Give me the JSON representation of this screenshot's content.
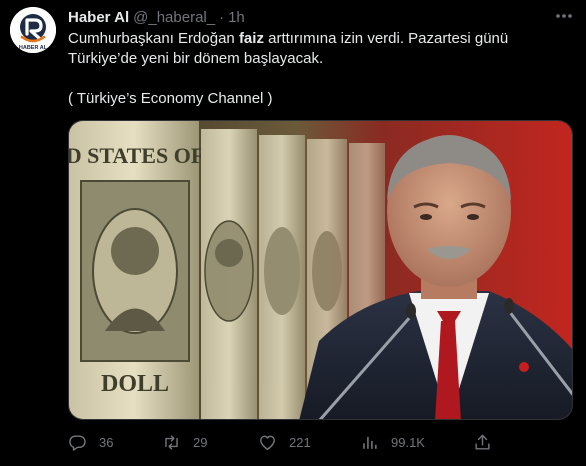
{
  "tweet": {
    "author": {
      "name": "Haber Al",
      "handle": "@_haberal_",
      "separator": "·",
      "time": "1h",
      "avatar_text": "HABER AL"
    },
    "text": {
      "line1_a": "Cumhurbaşkanı Erdoğan ",
      "line1_bold": "faiz",
      "line1_b": " arttırımına izin verdi. Pazartesi günü",
      "line2": "Türkiye’de yeni bir dönem başlayacak.",
      "line3": "( Türkiye’s Economy Channel )"
    },
    "media": {
      "description_icons": [
        "dollar-bill-roll",
        "portrait"
      ],
      "bill_text": "D STATES OF",
      "bill_text_2": "DOLL"
    },
    "actions": {
      "replies": "36",
      "retweets": "29",
      "likes": "221",
      "views": "99.1K"
    },
    "colors": {
      "background": "#000000",
      "text": "#e7e9ea",
      "muted": "#71767b",
      "brand_orange": "#e8731a"
    }
  }
}
